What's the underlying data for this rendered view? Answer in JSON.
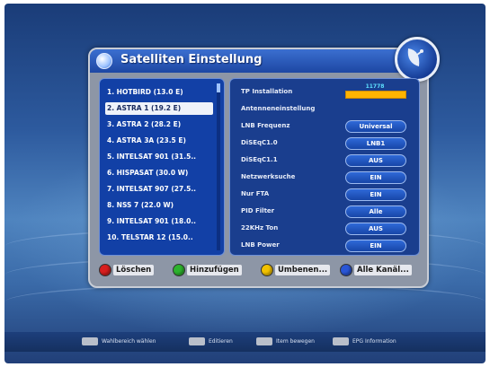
{
  "dialog": {
    "title": "Satelliten Einstellung",
    "icons": {
      "title": "globe-icon",
      "corner": "satellite-dish-icon"
    }
  },
  "satellites": [
    {
      "label": "1. HOTBIRD (13.0 E)",
      "selected": false
    },
    {
      "label": "2. ASTRA 1 (19.2 E)",
      "selected": true
    },
    {
      "label": "3. ASTRA 2 (28.2 E)",
      "selected": false
    },
    {
      "label": "4. ASTRA 3A (23.5 E)",
      "selected": false
    },
    {
      "label": "5. INTELSAT 901 (31.5..",
      "selected": false
    },
    {
      "label": "6. HISPASAT (30.0 W)",
      "selected": false
    },
    {
      "label": "7. INTELSAT 907 (27.5..",
      "selected": false
    },
    {
      "label": "8. NSS 7 (22.0 W)",
      "selected": false
    },
    {
      "label": "9. INTELSAT 901 (18.0..",
      "selected": false
    },
    {
      "label": "10. TELSTAR 12 (15.0..",
      "selected": false
    }
  ],
  "settings": {
    "tp_label": "TP Installation",
    "tp_value": "11778",
    "antenna_label": "Antenneneinstellung",
    "rows": [
      {
        "label": "LNB Frequenz",
        "value": "Universal"
      },
      {
        "label": "DiSEqC1.0",
        "value": "LNB1"
      },
      {
        "label": "DiSEqC1.1",
        "value": "AUS"
      },
      {
        "label": "Netzwerksuche",
        "value": "EIN"
      },
      {
        "label": "Nur FTA",
        "value": "EIN"
      },
      {
        "label": "PID Filter",
        "value": "Alle"
      },
      {
        "label": "22KHz Ton",
        "value": "AUS"
      },
      {
        "label": "LNB Power",
        "value": "EIN"
      }
    ]
  },
  "footer": [
    {
      "label": "Löschen",
      "color": "#d81e1e"
    },
    {
      "label": "Hinzufügen",
      "color": "#2db32d"
    },
    {
      "label": "Umbenen...",
      "color": "#f2c200"
    },
    {
      "label": "Alle Kanäl...",
      "color": "#2a56d6"
    }
  ],
  "hints": [
    {
      "key": "OK",
      "text": "Wahlbereich wählen"
    },
    {
      "key": "EDIT",
      "text": "Editieren"
    },
    {
      "key": "SCAN",
      "text": "Item bewegen"
    },
    {
      "key": "EPG",
      "text": "EPG Information"
    }
  ]
}
